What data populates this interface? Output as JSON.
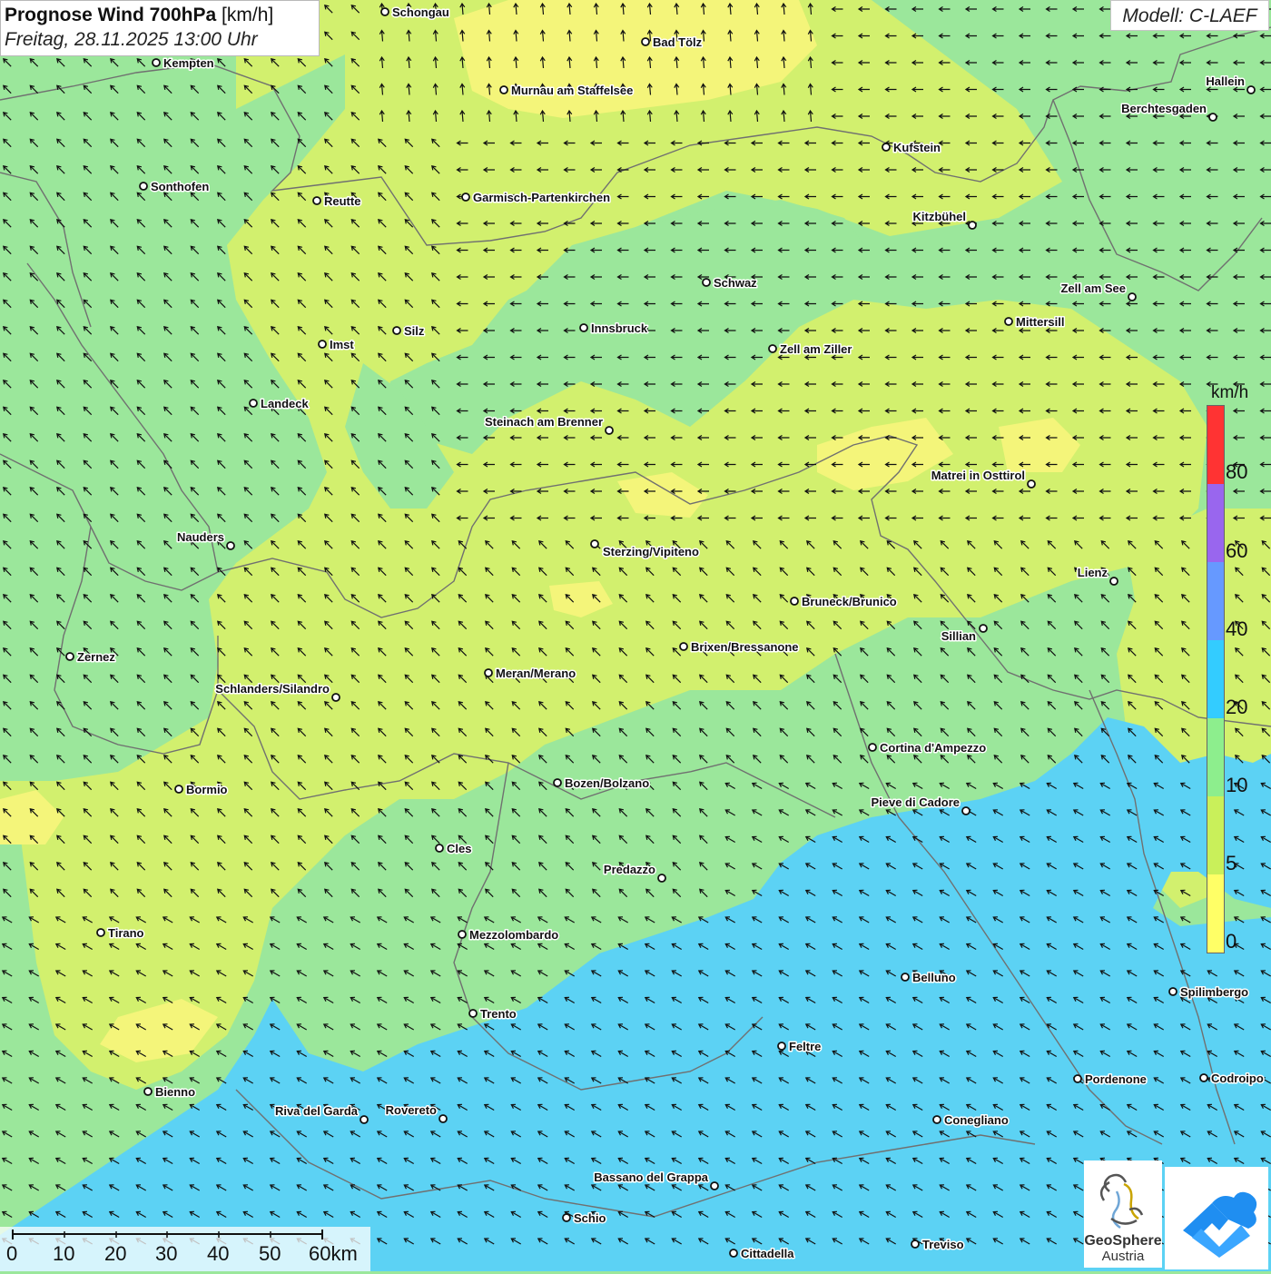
{
  "title": {
    "main_bold": "Prognose Wind 700hPa",
    "main_unit": "[km/h]",
    "subtitle": "Freitag, 28.11.2025 13:00 Uhr"
  },
  "model": "Modell: C-LAEF",
  "legend": {
    "unit": "km/h",
    "ticks": [
      "80",
      "60",
      "40",
      "20",
      "10",
      "5",
      "0"
    ],
    "colors": [
      "#ff3333",
      "#9966ee",
      "#6699ff",
      "#33ccff",
      "#8dee8d",
      "#c9f05a",
      "#ffff66"
    ]
  },
  "scale_bar": {
    "labels": [
      "0",
      "10",
      "20",
      "30",
      "40",
      "50",
      "60km"
    ]
  },
  "cities": [
    {
      "name": "Schongau"
    },
    {
      "name": "Bad Tölz"
    },
    {
      "name": "Kempten"
    },
    {
      "name": "Murnau am Staffelsee"
    },
    {
      "name": "Hallein"
    },
    {
      "name": "Berchtesgaden"
    },
    {
      "name": "Kufstein"
    },
    {
      "name": "Sonthofen"
    },
    {
      "name": "Reutte"
    },
    {
      "name": "Garmisch-Partenkirchen"
    },
    {
      "name": "Kitzbühel"
    },
    {
      "name": "Schwaz"
    },
    {
      "name": "Zell am See"
    },
    {
      "name": "Mittersill"
    },
    {
      "name": "Innsbruck"
    },
    {
      "name": "Silz"
    },
    {
      "name": "Imst"
    },
    {
      "name": "Zell am Ziller"
    },
    {
      "name": "Landeck"
    },
    {
      "name": "Steinach am Brenner"
    },
    {
      "name": "Matrei in Osttirol"
    },
    {
      "name": "Nauders"
    },
    {
      "name": "Sterzing/Vipiteno"
    },
    {
      "name": "Lienz"
    },
    {
      "name": "Bruneck/Brunico"
    },
    {
      "name": "Sillian"
    },
    {
      "name": "Brixen/Bressanone"
    },
    {
      "name": "Zernez"
    },
    {
      "name": "Meran/Merano"
    },
    {
      "name": "Schlanders/Silandro"
    },
    {
      "name": "Cortina d'Ampezzo"
    },
    {
      "name": "Bozen/Bolzano"
    },
    {
      "name": "Bormio"
    },
    {
      "name": "Pieve di Cadore"
    },
    {
      "name": "Cles"
    },
    {
      "name": "Predazzo"
    },
    {
      "name": "Tirano"
    },
    {
      "name": "Mezzolombardo"
    },
    {
      "name": "Belluno"
    },
    {
      "name": "Spilimbergo"
    },
    {
      "name": "Trento"
    },
    {
      "name": "Feltre"
    },
    {
      "name": "Pordenone"
    },
    {
      "name": "Codroipo"
    },
    {
      "name": "Bienno"
    },
    {
      "name": "Riva del Garda"
    },
    {
      "name": "Rovereto"
    },
    {
      "name": "Conegliano"
    },
    {
      "name": "Bassano del Grappa"
    },
    {
      "name": "Schio"
    },
    {
      "name": "Treviso"
    },
    {
      "name": "Cittadella"
    }
  ],
  "logo": {
    "name_line1": "GeoSphere",
    "name_line2": "Austria"
  },
  "colors": {
    "zone_yellow": "#f4f57a",
    "zone_yellowgreen": "#d2f06e",
    "zone_green": "#9be79b",
    "zone_blue": "#5cd2f4",
    "arrow": "#111111"
  }
}
